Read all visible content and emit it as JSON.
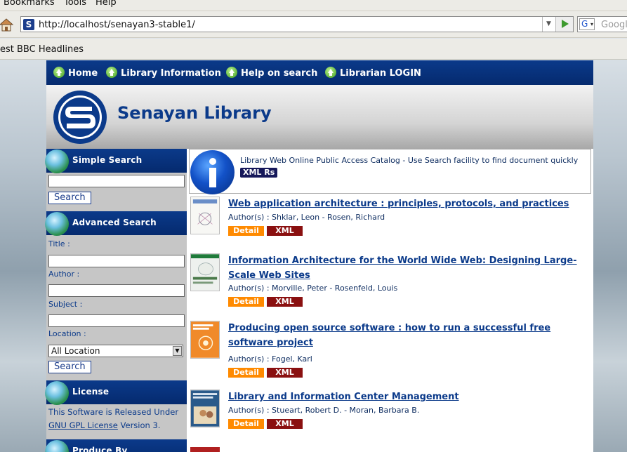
{
  "browser": {
    "menu": [
      "Bookmarks",
      "Tools",
      "Help"
    ],
    "url": "http://localhost/senayan3-stable1/",
    "search_placeholder": "Googl",
    "search_engine": "G",
    "bookmark": "est BBC Headlines"
  },
  "nav": {
    "items": [
      "Home",
      "Library Information",
      "Help on search",
      "Librarian LOGIN"
    ]
  },
  "header": {
    "title": "Senayan Library"
  },
  "sidebar": {
    "simple_search": {
      "heading": "Simple Search",
      "button": "Search"
    },
    "advanced_search": {
      "heading": "Advanced Search",
      "title_label": "Title :",
      "author_label": "Author :",
      "subject_label": "Subject :",
      "location_label": "Location :",
      "location_value": "All Location",
      "button": "Search"
    },
    "license": {
      "heading": "License",
      "text1": "This Software is Released Under",
      "link": "GNU GPL License",
      "text2": " Version 3."
    },
    "produced": {
      "heading": "Produce By"
    }
  },
  "main": {
    "info": {
      "text": "Library Web Online Public Access Catalog - Use Search facility to find document quickly",
      "xml_rs": "XML Rs"
    },
    "detail_label": "Detail",
    "xml_label": "XML",
    "items": [
      {
        "title": "Web application architecture : principles, protocols, and practices",
        "authors": "Author(s) : Shklar, Leon - Rosen, Richard"
      },
      {
        "title": "Information Architecture for the World Wide Web: Designing Large-Scale Web Sites",
        "authors": "Author(s) : Morville, Peter - Rosenfeld, Louis"
      },
      {
        "title": "Producing open source software : how to run a successful free software project",
        "authors": "Author(s) : Fogel, Karl"
      },
      {
        "title": "Library and Information Center Management",
        "authors": "Author(s) : Stueart, Robert D. - Moran, Barbara B."
      }
    ]
  },
  "colors": {
    "nav_blue": "#0b3a8a",
    "detail_orange": "#ff8a00",
    "xml_red": "#8a1010"
  }
}
